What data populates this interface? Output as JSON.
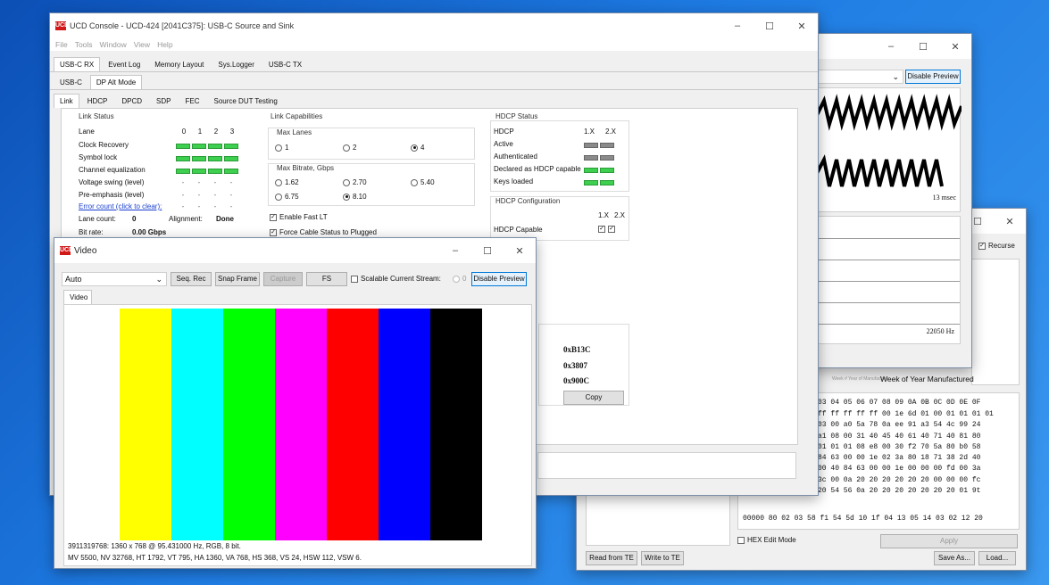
{
  "main": {
    "title": "UCD Console - UCD-424 [2041C375]: USB-C Source and Sink",
    "logo": "UCD",
    "menu": [
      "File",
      "Tools",
      "Window",
      "View",
      "Help"
    ],
    "tabs": [
      "USB-C RX",
      "Event Log",
      "Memory Layout",
      "Sys.Logger",
      "USB-C TX"
    ],
    "subtabs": [
      "USB-C",
      "DP Alt Mode"
    ],
    "subtabs2": [
      "Link",
      "HDCP",
      "DPCD",
      "SDP",
      "FEC",
      "Source DUT Testing"
    ],
    "link_status": {
      "title": "Link Status",
      "lane_label": "Lane",
      "lanes": [
        "0",
        "1",
        "2",
        "3"
      ],
      "rows": [
        "Clock Recovery",
        "Symbol lock",
        "Channel equalization",
        "Voltage swing (level)",
        "Pre-emphasis (level)"
      ],
      "error_link": "Error count (click to clear):",
      "lane_count_label": "Lane count:",
      "lane_count": "0",
      "alignment_label": "Alignment:",
      "alignment": "Done",
      "bit_rate_label": "Bit rate:",
      "bit_rate": "0.00 Gbps",
      "dash": "-"
    },
    "link_caps": {
      "title": "Link Capabilities",
      "max_lanes_title": "Max Lanes",
      "lanes": [
        "1",
        "2",
        "4"
      ],
      "bitrate_title": "Max Bitrate, Gbps",
      "bitrates": [
        "1.62",
        "2.70",
        "5.40",
        "6.75",
        "8.10"
      ],
      "enable_fast_lt": "Enable Fast LT",
      "force_cable": "Force Cable Status to Plugged"
    },
    "hdcp_status": {
      "title": "HDCP Status",
      "hdcp": "HDCP",
      "v1": "1.X",
      "v2": "2.X",
      "rows": [
        "Active",
        "Authenticated",
        "Declared as HDCP capable",
        "Keys loaded"
      ]
    },
    "hdcp_config": {
      "title": "HDCP Configuration",
      "v1": "1.X",
      "v2": "2.X",
      "capable": "HDCP Capable"
    },
    "ids": [
      "0xB13C",
      "0x3807",
      "0x900C"
    ],
    "copy": "Copy"
  },
  "video": {
    "title": "Video",
    "logo": "UCD",
    "mode": "Auto",
    "seq_rec": "Seq. Rec",
    "snap": "Snap Frame",
    "capture": "Capture",
    "fs": "FS",
    "scalable": "Scalable",
    "current_stream": "Current Stream:",
    "stream_value": "0",
    "disable_preview": "Disable Preview",
    "tab": "Video",
    "bars": [
      "#ffffff",
      "#ffff00",
      "#00ffff",
      "#00ff00",
      "#ff00ff",
      "#ff0000",
      "#0000ff",
      "#000000"
    ],
    "status1": "3911319768: 1360 x 768 @ 95.431000 Hz,  RGB, 8 bit.",
    "status2": "MV 5500, NV 32768, HT 1792, VT 795, HA 1360, VA 768, HS 368, VS 24, HSW 112, VSW 6."
  },
  "audio": {
    "disable_preview": "Disable Preview",
    "time": "13 msec",
    "freq": "22050 Hz"
  },
  "edid": {
    "recurse": "Recurse",
    "week_label": "Week of Year Manufactured",
    "week_small": "Week # Year of Manufacture",
    "hex_header": "03 04 05 06 07 08 09 0A 0B 0C 0D 0E 0F",
    "hex_rows": [
      "ff ff ff ff ff 00 1e 6d 01 00 01 01 01 01",
      "03 00 a0 5a 78 0a ee 91 a3 54 4c 99 24",
      "a1 08 00 31 40 45 40 61 40 71 40 81 80",
      "01 01 01 08 e8 00 30 f2 70 5a 80 b0 58",
      "84 63 00 00 1e 02 3a 80 18 71 38 2d 40",
      "00 40 84 63 00 00 1e 00 00 00 fd 00 3a",
      "3c 00 0a 20 20 20 20 20 20 00 00 00 fc",
      "20 54 56 0a 20 20 20 20 20 20 20 01 9t"
    ],
    "last_row": "00000 80 02 03 58 f1 54 5d 10 1f 04 13 05 14 03 02 12 20",
    "hex_edit": "HEX Edit Mode",
    "apply": "Apply",
    "read_te": "Read from TE",
    "write_te": "Write to TE",
    "save_as": "Save As...",
    "load": "Load..."
  }
}
